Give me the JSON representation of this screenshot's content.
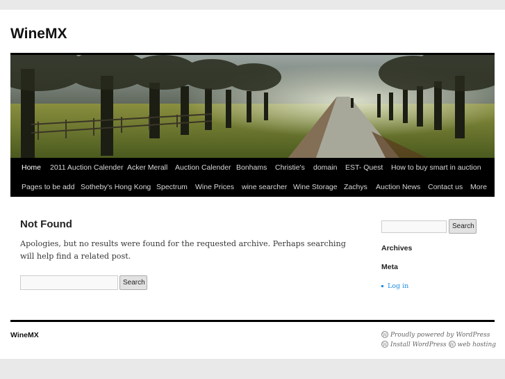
{
  "site": {
    "title": "WineMX"
  },
  "nav": {
    "row1": [
      {
        "label": "Home",
        "current": true
      },
      {
        "label": "2011 Auction Calender"
      },
      {
        "label": "Acker Merall"
      },
      {
        "label": "Auction Calender"
      },
      {
        "label": "Bonhams"
      },
      {
        "label": "Christie's"
      },
      {
        "label": "domain"
      },
      {
        "label": "EST- Quest"
      },
      {
        "label": "How to buy smart in auction"
      }
    ],
    "row2": [
      {
        "label": "Pages to be add"
      },
      {
        "label": "Sotheby's Hong Kong"
      },
      {
        "label": "Spectrum"
      },
      {
        "label": "Wine Prices"
      },
      {
        "label": "wine searcher"
      },
      {
        "label": "Wine Storage"
      },
      {
        "label": "Zachys"
      },
      {
        "label": "Auction News"
      },
      {
        "label": "Contact us"
      },
      {
        "label": "More"
      }
    ]
  },
  "main": {
    "title": "Not Found",
    "message": "Apologies, but no results were found for the requested archive. Perhaps searching will help find a related post.",
    "search": {
      "value": "",
      "button": "Search"
    }
  },
  "sidebar": {
    "search": {
      "value": "",
      "button": "Search"
    },
    "archives_title": "Archives",
    "meta_title": "Meta",
    "meta_links": [
      "Log in"
    ]
  },
  "footer": {
    "title": "WineMX",
    "credit1": "Proudly powered by WordPress",
    "credit2_a": "Install WordPress",
    "credit2_b": "web hosting"
  },
  "colors": {
    "background": "#e9e9e9",
    "page": "#ffffff",
    "nav": "#000000",
    "link": "#1b8be0"
  }
}
